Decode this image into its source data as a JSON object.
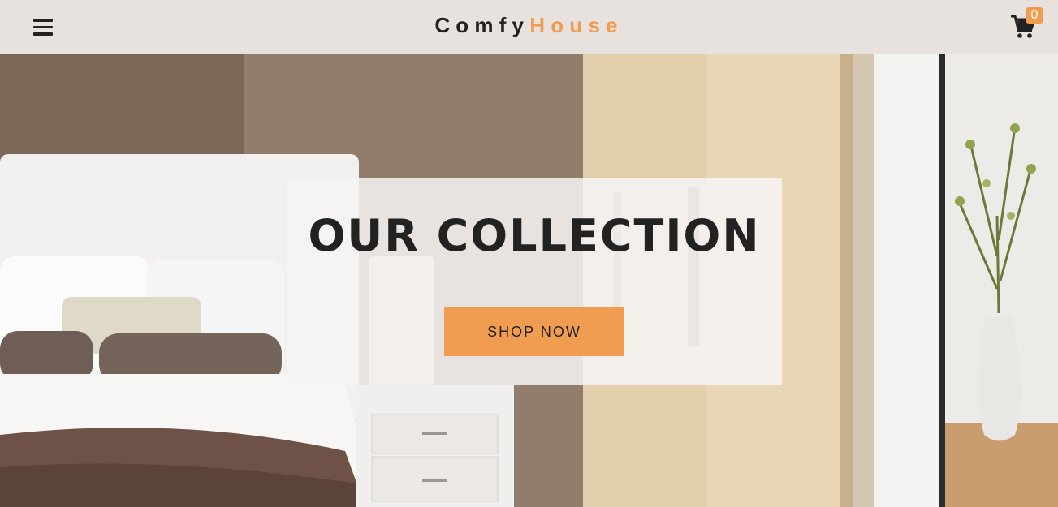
{
  "navbar": {
    "menu_icon": "hamburger-menu-icon",
    "logo_part1": "Comfy",
    "logo_part2": "House",
    "cart_icon": "shopping-cart-icon",
    "cart_count": "0"
  },
  "hero": {
    "title": "OUR COLLECTION",
    "button_label": "SHOP NOW"
  },
  "colors": {
    "primary": "#f09d51",
    "navbar_bg": "#e7e2dd",
    "text_dark": "#222222"
  }
}
